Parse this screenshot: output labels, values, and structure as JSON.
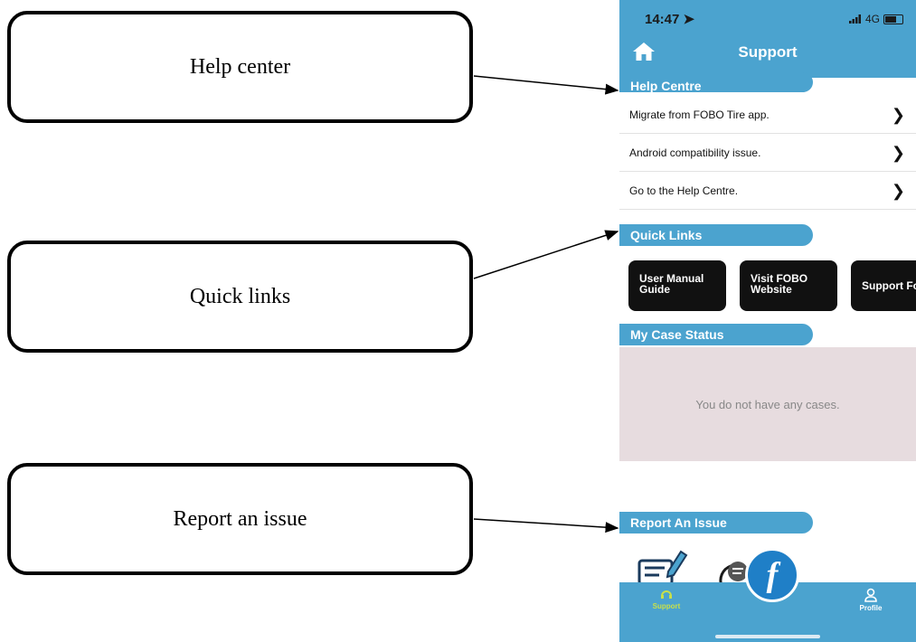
{
  "callouts": {
    "help": "Help center",
    "quick": "Quick links",
    "report": "Report an issue"
  },
  "status": {
    "time": "14:47",
    "network": "4G"
  },
  "header": {
    "title": "Support",
    "home_icon": "home-icon"
  },
  "help_centre": {
    "heading": "Help Centre",
    "items": [
      {
        "label": "Migrate from FOBO Tire app."
      },
      {
        "label": "Android compatibility issue."
      },
      {
        "label": "Go to the Help Centre."
      }
    ]
  },
  "quick_links": {
    "heading": "Quick Links",
    "buttons": [
      {
        "line1": "User Manual",
        "line2": "Guide"
      },
      {
        "line1": "Visit FOBO",
        "line2": "Website"
      },
      {
        "line1": "Support Fo",
        "line2": ""
      }
    ]
  },
  "case_status": {
    "heading": "My Case Status",
    "empty_text": "You do not have any cases."
  },
  "report_issue": {
    "heading": "Report An Issue"
  },
  "tabbar": {
    "support_label": "Support",
    "profile_label": "Profile",
    "fab_letter": "f"
  },
  "colors": {
    "accent": "#4ba3cf",
    "active_tab": "#c8e04a",
    "case_bg": "#e7dcdf"
  }
}
